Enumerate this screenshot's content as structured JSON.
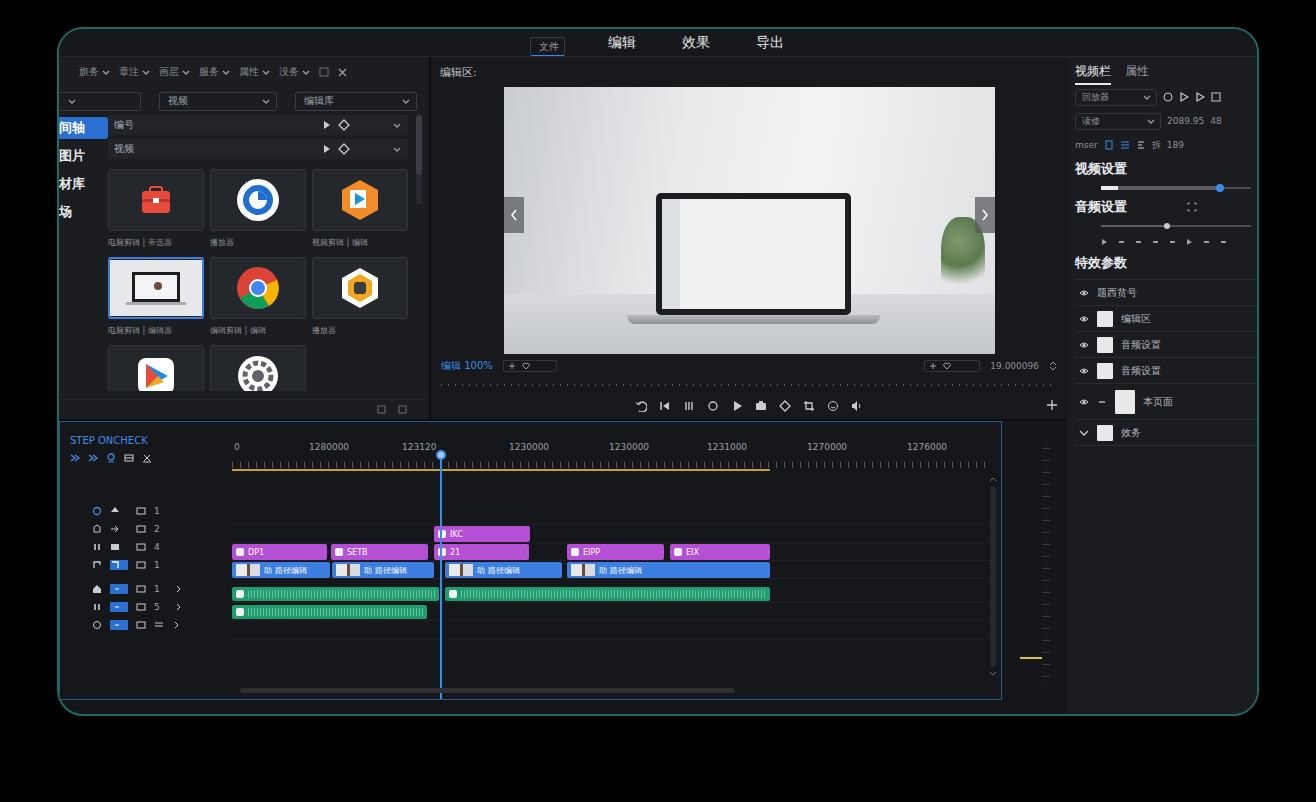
{
  "menu": [
    {
      "label": "文件",
      "selected": true
    },
    {
      "label": "编辑",
      "selected": false
    },
    {
      "label": "效果",
      "selected": false
    },
    {
      "label": "导出",
      "selected": false
    }
  ],
  "media": {
    "filters": [
      "旗务",
      "章注",
      "画层",
      "服务",
      "属性",
      "没务"
    ],
    "selects": [
      "视频",
      "编辑库"
    ],
    "nav": [
      {
        "label": "间轴",
        "selected": true
      },
      {
        "label": "图片",
        "selected": false
      },
      {
        "label": "材库",
        "selected": false
      },
      {
        "label": "场",
        "selected": false
      }
    ],
    "rows": [
      "编号",
      "视频"
    ],
    "tiles": [
      {
        "label": "电脑剪辑 | 帝选器",
        "selected": false
      },
      {
        "label": "播放器",
        "selected": false
      },
      {
        "label": "视频剪辑 | 编辑",
        "selected": false
      },
      {
        "label": "电脑剪辑 | 编辑器",
        "selected": true
      },
      {
        "label": "编辑剪辑 | 编辑",
        "selected": false
      },
      {
        "label": "播放器",
        "selected": false
      },
      {
        "selected": false
      },
      {
        "selected": false
      }
    ]
  },
  "preview": {
    "title": "编辑区:",
    "zoom": "编辑 100%",
    "timecode": "19.000096"
  },
  "timeline": {
    "caption": "STEP ONCHECK",
    "ruler": [
      "0",
      "1280000",
      "123120",
      "1230000",
      "1230000",
      "1231000",
      "1270000",
      "1276000"
    ],
    "playhead": {
      "level": 0.274
    },
    "tracks": [
      {
        "number": "1",
        "armed": false
      },
      {
        "number": "2",
        "armed": false
      },
      {
        "number": "4",
        "armed": false
      },
      {
        "number": "1",
        "armed": true
      },
      {
        "number": "1",
        "armed": true
      },
      {
        "number": "5",
        "armed": true
      },
      {
        "armed": true
      }
    ],
    "clips": [
      {
        "label": "IKC",
        "kind": "title"
      },
      {
        "label": "DP1",
        "kind": "title"
      },
      {
        "label": "SETB",
        "kind": "title"
      },
      {
        "label": "21",
        "kind": "title"
      },
      {
        "label": "EIPP",
        "kind": "title"
      },
      {
        "label": "EIX",
        "kind": "title"
      },
      {
        "label": "助 路径编辑",
        "kind": "video"
      },
      {
        "label": "助 路径编辑",
        "kind": "video"
      },
      {
        "label": "助 路径编辑",
        "kind": "video"
      },
      {
        "label": "助 路径编辑",
        "kind": "video"
      },
      {
        "kind": "audio"
      },
      {
        "kind": "audio"
      },
      {
        "kind": "audio"
      }
    ],
    "meter": {
      "level": 0.12
    }
  },
  "inspector": {
    "tabs": [
      {
        "label": "视频栏",
        "selected": true
      },
      {
        "label": "属性",
        "selected": false
      }
    ],
    "player_select": "回放器",
    "mode_select": "读修",
    "time": "2089.95",
    "frames": "48",
    "mode_label": "mser",
    "split": "拆",
    "count": "189",
    "video_heading": "视频设置",
    "video_level": 0.79,
    "audio_heading": "音频设置",
    "audio_level": 0.44,
    "effects_heading": "特效参数",
    "effects": [
      {
        "label": "题西贫号",
        "kind": "header"
      },
      {
        "label": "编辑区",
        "kind": "item"
      },
      {
        "label": "音频设置",
        "kind": "item"
      },
      {
        "label": "音频设置",
        "kind": "item"
      },
      {
        "label": "本页面",
        "kind": "group"
      },
      {
        "label": "效务",
        "kind": "folder"
      }
    ]
  }
}
